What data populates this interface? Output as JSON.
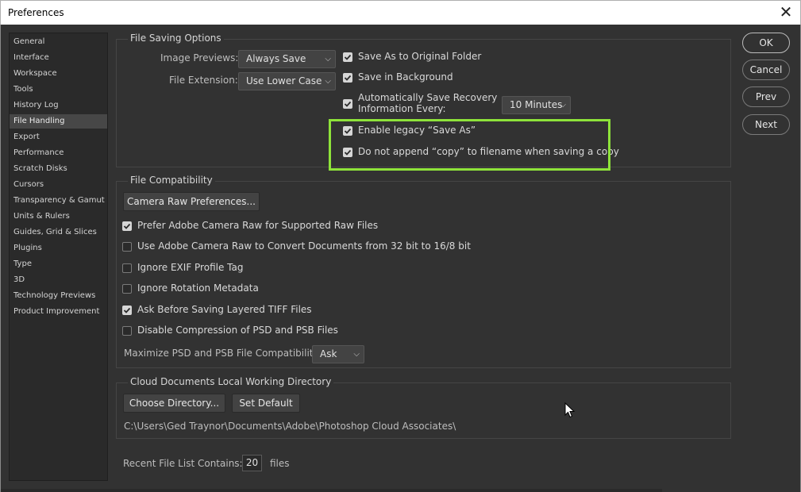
{
  "window": {
    "title": "Preferences",
    "close_glyph": "✕"
  },
  "sidebar": {
    "items": [
      {
        "label": "General"
      },
      {
        "label": "Interface"
      },
      {
        "label": "Workspace"
      },
      {
        "label": "Tools"
      },
      {
        "label": "History Log"
      },
      {
        "label": "File Handling"
      },
      {
        "label": "Export"
      },
      {
        "label": "Performance"
      },
      {
        "label": "Scratch Disks"
      },
      {
        "label": "Cursors"
      },
      {
        "label": "Transparency & Gamut"
      },
      {
        "label": "Units & Rulers"
      },
      {
        "label": "Guides, Grid & Slices"
      },
      {
        "label": "Plugins"
      },
      {
        "label": "Type"
      },
      {
        "label": "3D"
      },
      {
        "label": "Technology Previews"
      },
      {
        "label": "Product Improvement"
      }
    ],
    "selected": "File Handling"
  },
  "file_saving": {
    "title": "File Saving Options",
    "image_previews_label": "Image Previews:",
    "image_previews_value": "Always Save",
    "file_extension_label": "File Extension:",
    "file_extension_value": "Use Lower Case",
    "save_as_original": {
      "label": "Save As to Original Folder",
      "checked": true
    },
    "save_in_background": {
      "label": "Save in Background",
      "checked": true
    },
    "auto_save": {
      "label_line1": "Automatically Save Recovery",
      "label_line2": "Information Every:",
      "checked": true
    },
    "auto_save_interval": "10 Minutes",
    "legacy_save_as": {
      "label": "Enable legacy “Save As”",
      "checked": true
    },
    "no_append_copy": {
      "label": "Do not append “copy” to filename when saving a copy",
      "checked": true
    }
  },
  "file_compat": {
    "title": "File Compatibility",
    "camera_raw_button": "Camera Raw Preferences...",
    "options": [
      {
        "label": "Prefer Adobe Camera Raw for Supported Raw Files",
        "checked": true
      },
      {
        "label": "Use Adobe Camera Raw to Convert Documents from 32 bit to 16/8 bit",
        "checked": false
      },
      {
        "label": "Ignore EXIF Profile Tag",
        "checked": false
      },
      {
        "label": "Ignore Rotation Metadata",
        "checked": false
      },
      {
        "label": "Ask Before Saving Layered TIFF Files",
        "checked": true
      },
      {
        "label": "Disable Compression of PSD and PSB Files",
        "checked": false
      }
    ],
    "maximize_label": "Maximize PSD and PSB File Compatibility:",
    "maximize_value": "Ask"
  },
  "cloud": {
    "title": "Cloud Documents Local Working Directory",
    "choose_button": "Choose Directory...",
    "default_button": "Set Default",
    "path": "C:\\Users\\Ged Traynor\\Documents\\Adobe\\Photoshop Cloud Associates\\"
  },
  "recent": {
    "label": "Recent File List Contains:",
    "value": "20",
    "suffix": "files"
  },
  "actions": {
    "ok": "OK",
    "cancel": "Cancel",
    "prev": "Prev",
    "next": "Next"
  },
  "colors": {
    "highlight": "#8ee33a",
    "panel": "#323232",
    "sidebar": "#2a2a2a"
  }
}
